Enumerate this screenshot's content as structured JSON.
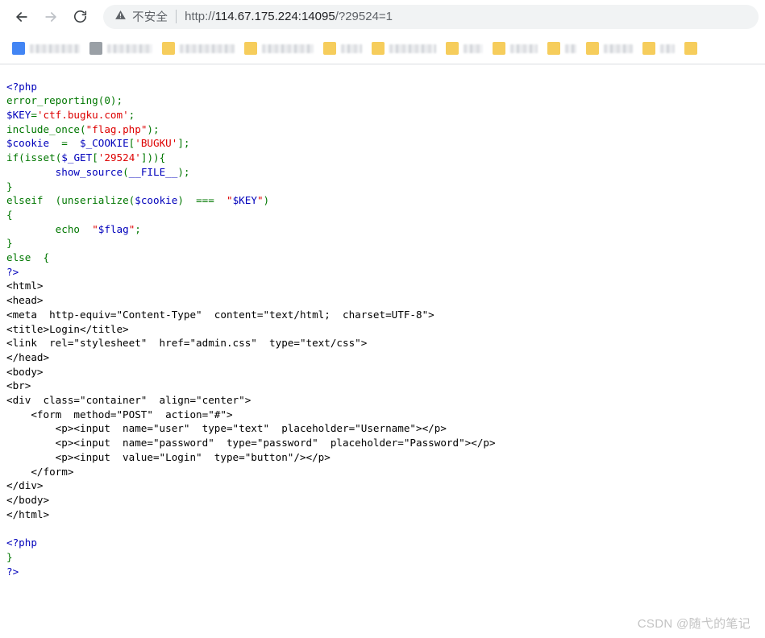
{
  "browser": {
    "nav": {
      "back_icon": "arrow-left-icon",
      "forward_icon": "arrow-right-icon",
      "reload_icon": "reload-icon"
    },
    "omnibox": {
      "warning_icon": "warning-triangle-icon",
      "security_label": "不安全",
      "url_scheme": "http://",
      "url_host": "114.67.175.224:14095",
      "url_path": "/?29524=1",
      "full_url": "http://114.67.175.224:14095/?29524=1"
    },
    "bookmarks": [
      {
        "icon": "chrome-bookmark-icon",
        "label": "",
        "label_width": 62,
        "redacted": true
      },
      {
        "icon": "bookmark-icon",
        "label": "",
        "label_width": 56,
        "redacted": true
      },
      {
        "icon": "folder-icon",
        "label": "",
        "label_width": 68,
        "redacted": true
      },
      {
        "icon": "folder-icon",
        "label": "",
        "label_width": 64,
        "redacted": true
      },
      {
        "icon": "folder-icon",
        "label": "",
        "label_width": 26,
        "redacted": true
      },
      {
        "icon": "folder-icon",
        "label": "",
        "label_width": 58,
        "redacted": true
      },
      {
        "icon": "folder-icon",
        "label": "",
        "label_width": 24,
        "redacted": true
      },
      {
        "icon": "folder-icon",
        "label": "",
        "label_width": 34,
        "redacted": true
      },
      {
        "icon": "folder-icon",
        "label": "",
        "label_width": 14,
        "redacted": true
      },
      {
        "icon": "folder-icon",
        "label": "",
        "label_width": 36,
        "redacted": true
      },
      {
        "icon": "folder-icon",
        "label": "",
        "label_width": 18,
        "redacted": true
      },
      {
        "icon": "folder-icon",
        "label": "",
        "label_width": 0,
        "redacted": true
      }
    ]
  },
  "source_code": {
    "language": "php",
    "lines": [
      [
        {
          "t": "<?php",
          "c": "php"
        }
      ],
      [
        {
          "t": "error_reporting",
          "c": "keyword"
        },
        {
          "t": "(",
          "c": "keyword"
        },
        {
          "t": "0",
          "c": "keyword"
        },
        {
          "t": ");",
          "c": "keyword"
        }
      ],
      [
        {
          "t": "$KEY",
          "c": "php"
        },
        {
          "t": "=",
          "c": "keyword"
        },
        {
          "t": "'ctf.bugku.com'",
          "c": "string"
        },
        {
          "t": ";",
          "c": "keyword"
        }
      ],
      [
        {
          "t": "include_once",
          "c": "keyword"
        },
        {
          "t": "(",
          "c": "keyword"
        },
        {
          "t": "\"flag.php\"",
          "c": "string"
        },
        {
          "t": ");",
          "c": "keyword"
        }
      ],
      [
        {
          "t": "$cookie",
          "c": "php"
        },
        {
          "t": "  =  ",
          "c": "keyword"
        },
        {
          "t": "$_COOKIE",
          "c": "php"
        },
        {
          "t": "[",
          "c": "keyword"
        },
        {
          "t": "'BUGKU'",
          "c": "string"
        },
        {
          "t": "];",
          "c": "keyword"
        }
      ],
      [
        {
          "t": "if",
          "c": "keyword"
        },
        {
          "t": "(",
          "c": "keyword"
        },
        {
          "t": "isset",
          "c": "keyword"
        },
        {
          "t": "(",
          "c": "keyword"
        },
        {
          "t": "$_GET",
          "c": "php"
        },
        {
          "t": "[",
          "c": "keyword"
        },
        {
          "t": "'29524'",
          "c": "string"
        },
        {
          "t": "])){",
          "c": "keyword"
        }
      ],
      [
        {
          "t": "        ",
          "c": "default"
        },
        {
          "t": "show_source",
          "c": "func"
        },
        {
          "t": "(",
          "c": "keyword"
        },
        {
          "t": "__FILE__",
          "c": "func"
        },
        {
          "t": ");",
          "c": "keyword"
        }
      ],
      [
        {
          "t": "}",
          "c": "keyword"
        }
      ],
      [
        {
          "t": "elseif",
          "c": "keyword"
        },
        {
          "t": "  (",
          "c": "keyword"
        },
        {
          "t": "unserialize",
          "c": "keyword"
        },
        {
          "t": "(",
          "c": "keyword"
        },
        {
          "t": "$cookie",
          "c": "php"
        },
        {
          "t": ")  ",
          "c": "keyword"
        },
        {
          "t": "===",
          "c": "keyword"
        },
        {
          "t": "  ",
          "c": "keyword"
        },
        {
          "t": "\"",
          "c": "string"
        },
        {
          "t": "$KEY",
          "c": "php"
        },
        {
          "t": "\"",
          "c": "string"
        },
        {
          "t": ")",
          "c": "keyword"
        }
      ],
      [
        {
          "t": "{",
          "c": "keyword"
        }
      ],
      [
        {
          "t": "        ",
          "c": "default"
        },
        {
          "t": "echo",
          "c": "keyword"
        },
        {
          "t": "  ",
          "c": "keyword"
        },
        {
          "t": "\"",
          "c": "string"
        },
        {
          "t": "$flag",
          "c": "php"
        },
        {
          "t": "\"",
          "c": "string"
        },
        {
          "t": ";",
          "c": "keyword"
        }
      ],
      [
        {
          "t": "}",
          "c": "keyword"
        }
      ],
      [
        {
          "t": "else",
          "c": "keyword"
        },
        {
          "t": "  {",
          "c": "keyword"
        }
      ],
      [
        {
          "t": "?>",
          "c": "php"
        }
      ],
      [
        {
          "t": "<html>",
          "c": "html"
        }
      ],
      [
        {
          "t": "<head>",
          "c": "html"
        }
      ],
      [
        {
          "t": "<meta  http-equiv=\"Content-Type\"  content=\"text/html;  charset=UTF-8\">",
          "c": "html"
        }
      ],
      [
        {
          "t": "<title>Login</title>",
          "c": "html"
        }
      ],
      [
        {
          "t": "<link  rel=\"stylesheet\"  href=\"admin.css\"  type=\"text/css\">",
          "c": "html"
        }
      ],
      [
        {
          "t": "</head>",
          "c": "html"
        }
      ],
      [
        {
          "t": "<body>",
          "c": "html"
        }
      ],
      [
        {
          "t": "<br>",
          "c": "html"
        }
      ],
      [
        {
          "t": "<div  class=\"container\"  align=\"center\">",
          "c": "html"
        }
      ],
      [
        {
          "t": "    <form  method=\"POST\"  action=\"#\">",
          "c": "html"
        }
      ],
      [
        {
          "t": "        <p><input  name=\"user\"  type=\"text\"  placeholder=\"Username\"></p>",
          "c": "html"
        }
      ],
      [
        {
          "t": "        <p><input  name=\"password\"  type=\"password\"  placeholder=\"Password\"></p>",
          "c": "html"
        }
      ],
      [
        {
          "t": "        <p><input  value=\"Login\"  type=\"button\"/></p>",
          "c": "html"
        }
      ],
      [
        {
          "t": "    </form>",
          "c": "html"
        }
      ],
      [
        {
          "t": "</div>",
          "c": "html"
        }
      ],
      [
        {
          "t": "</body>",
          "c": "html"
        }
      ],
      [
        {
          "t": "</html>",
          "c": "html"
        }
      ],
      [
        {
          "t": "",
          "c": "html"
        }
      ],
      [
        {
          "t": "<?php",
          "c": "php"
        }
      ],
      [
        {
          "t": "}",
          "c": "keyword"
        }
      ],
      [
        {
          "t": "?>",
          "c": "php"
        }
      ]
    ],
    "colors": {
      "default": "#000000",
      "php_tag_variable": "#0000bb",
      "keyword": "#007700",
      "string": "#dd0000",
      "html": "#000000"
    }
  },
  "watermark": {
    "text": "CSDN @随弋的笔记"
  }
}
